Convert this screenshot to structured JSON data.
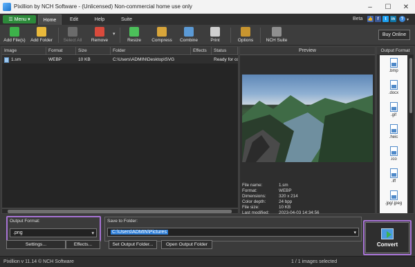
{
  "window": {
    "title": "Pixillion by NCH Software - (Unlicensed) Non-commercial home use only"
  },
  "menubar": {
    "menu_label": "Menu",
    "tabs": [
      "Home",
      "Edit",
      "Help",
      "Suite"
    ],
    "beta_label": "Beta"
  },
  "toolbar": {
    "buttons": [
      "Add File(s)",
      "Add Folder",
      "Select All",
      "Remove",
      "Resize",
      "Compress",
      "Combine",
      "Print",
      "Options",
      "NCH Suite"
    ],
    "buy_online": "Buy Online"
  },
  "file_table": {
    "columns": [
      "Image",
      "Format",
      "Size",
      "Folder",
      "Effects",
      "Status"
    ],
    "rows": [
      {
        "image": "1.sm",
        "format": "WEBP",
        "size": "10 KB",
        "folder": "C:\\Users\\ADMIN\\Desktop\\SVG",
        "effects": "",
        "status": "Ready for co"
      }
    ]
  },
  "preview": {
    "header": "Preview",
    "meta_labels": [
      "File name:",
      "Format:",
      "Dimensions:",
      "Color depth:",
      "File size:",
      "Last modified:"
    ],
    "meta_values": [
      "1.sm",
      "WEBP",
      "320 x 214",
      "24 bpp",
      "10 KB",
      "2023-04-03 14:34:56"
    ]
  },
  "output_format_panel": {
    "header": "Output Format",
    "formats": [
      ".bmp",
      ".docx",
      ".gif",
      ".heic",
      ".ico",
      ".iff",
      ".jpg/.jpeg"
    ]
  },
  "bottom": {
    "output_format_label": "Output Format:",
    "output_format_value": ".png",
    "settings_label": "Settings...",
    "effects_label": "Effects...",
    "save_to_label": "Save to Folder:",
    "save_to_value": "C:\\Users\\ADMIN\\Pictures",
    "set_output_label": "Set Output Folder...",
    "open_output_label": "Open Output Folder",
    "convert_label": "Convert"
  },
  "status": {
    "version": "Pixillion v 11.14 © NCH Software",
    "selection": "1 / 1 images selected"
  },
  "colors": {
    "accent_green": "#2d8a3b",
    "highlight": "#a874d6",
    "selection": "#2f7fd8"
  }
}
